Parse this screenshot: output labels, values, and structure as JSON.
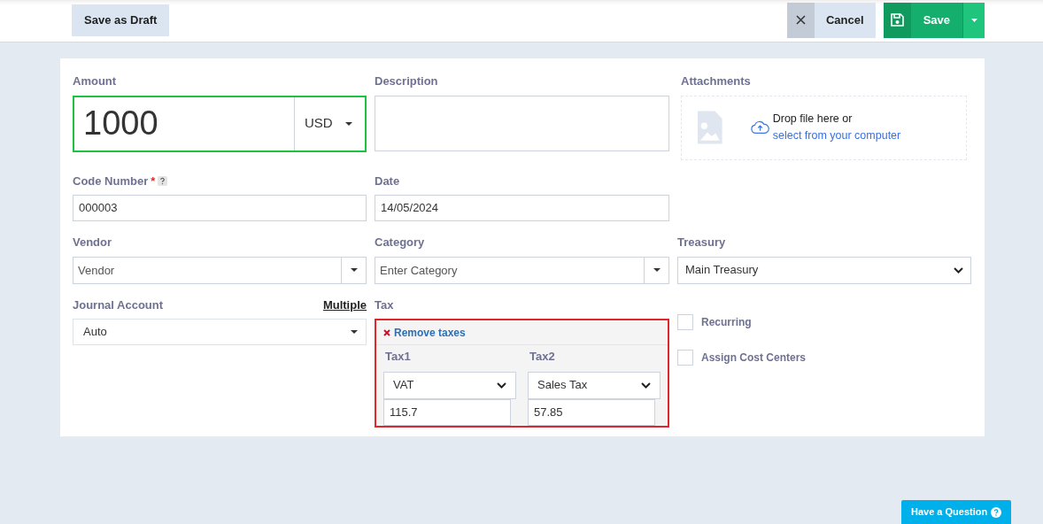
{
  "toolbar": {
    "draft_button": "Save as Draft",
    "cancel_button": "Cancel",
    "save_button": "Save"
  },
  "amount": {
    "label": "Amount",
    "value": "1000",
    "currency": "USD"
  },
  "description": {
    "label": "Description"
  },
  "attachments": {
    "label": "Attachments",
    "prompt": "Drop file here or",
    "link": "select from your computer"
  },
  "code_number": {
    "label": "Code Number",
    "required_mark": "*",
    "value": "000003"
  },
  "date": {
    "label": "Date",
    "value": "14/05/2024"
  },
  "vendor": {
    "label": "Vendor",
    "placeholder": "Vendor"
  },
  "category": {
    "label": "Category",
    "placeholder": "Enter Category"
  },
  "treasury": {
    "label": "Treasury",
    "value": "Main Treasury"
  },
  "journal_account": {
    "label": "Journal Account",
    "link": "Multiple",
    "value": "Auto"
  },
  "tax": {
    "label": "Tax",
    "remove_link": "Remove taxes",
    "taxes": [
      {
        "label": "Tax1",
        "type": "VAT",
        "amount": "115.7"
      },
      {
        "label": "Tax2",
        "type": "Sales Tax",
        "amount": "57.85"
      }
    ]
  },
  "options": [
    {
      "label": "Recurring",
      "checked": false
    },
    {
      "label": "Assign Cost Centers",
      "checked": false
    }
  ],
  "help_button": "Have a Question"
}
